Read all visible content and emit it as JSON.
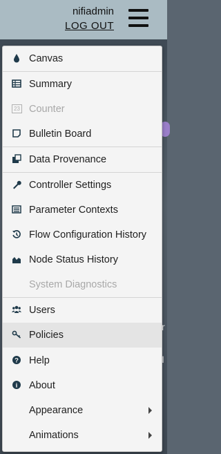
{
  "header": {
    "username": "nifiadmin",
    "logout_label": "LOG OUT"
  },
  "menu": {
    "items": [
      {
        "label": "Canvas",
        "icon": "drop-icon",
        "disabled": false
      },
      {
        "label": "Summary",
        "icon": "table-icon",
        "disabled": false
      },
      {
        "label": "Counter",
        "icon": "counter-icon",
        "disabled": true
      },
      {
        "label": "Bulletin Board",
        "icon": "sticky-note-icon",
        "disabled": false
      },
      {
        "label": "Data Provenance",
        "icon": "provenance-icon",
        "disabled": false
      },
      {
        "label": "Controller Settings",
        "icon": "wrench-icon",
        "disabled": false
      },
      {
        "label": "Parameter Contexts",
        "icon": "list-icon",
        "disabled": false
      },
      {
        "label": "Flow Configuration History",
        "icon": "history-icon",
        "disabled": false
      },
      {
        "label": "Node Status History",
        "icon": "area-chart-icon",
        "disabled": false
      },
      {
        "label": "System Diagnostics",
        "icon": "",
        "disabled": true
      },
      {
        "label": "Users",
        "icon": "users-icon",
        "disabled": false
      },
      {
        "label": "Policies",
        "icon": "key-icon",
        "disabled": false
      },
      {
        "label": "Help",
        "icon": "question-circle-icon",
        "disabled": false
      },
      {
        "label": "About",
        "icon": "info-circle-icon",
        "disabled": false
      },
      {
        "label": "Appearance",
        "icon": "",
        "disabled": false
      },
      {
        "label": "Animations",
        "icon": "",
        "disabled": false
      }
    ],
    "counter_badge": "23"
  },
  "background": {
    "text_a": "r",
    "text_b": "I"
  },
  "colors": {
    "header_bg": "#aabbc3",
    "menu_bg": "#f4f4f4",
    "icon": "#1f3a4a",
    "highlight": "#e4e4e4"
  }
}
